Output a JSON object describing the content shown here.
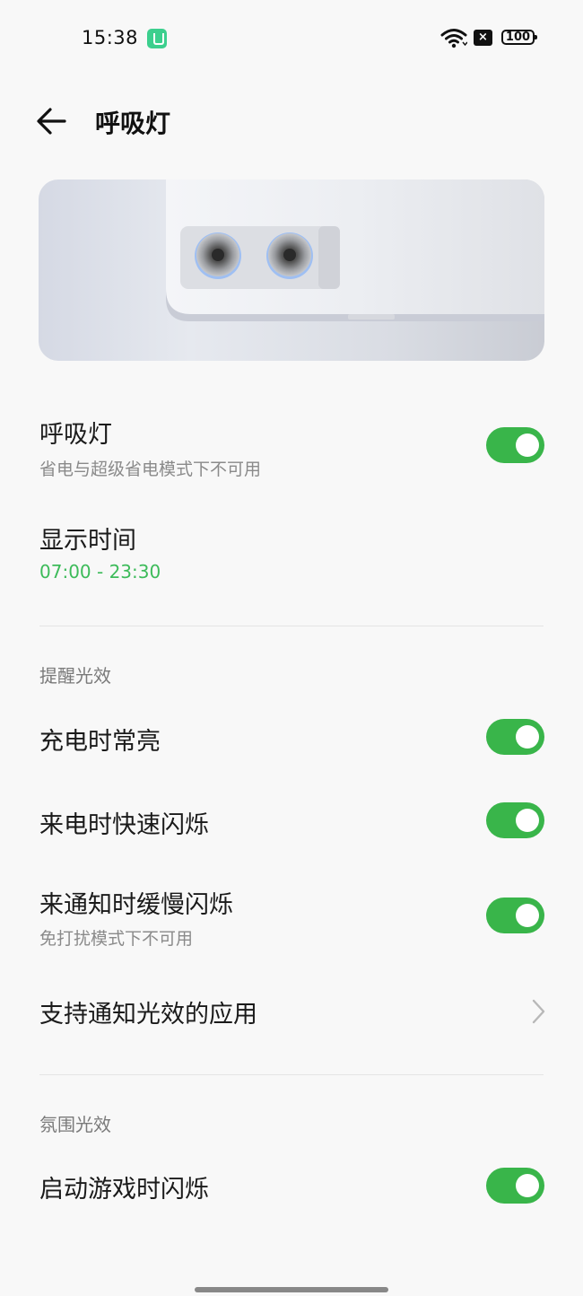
{
  "status_bar": {
    "time": "15:38",
    "battery": "100",
    "sim_status": "×"
  },
  "header": {
    "title": "呼吸灯"
  },
  "settings": {
    "breathing_light": {
      "title": "呼吸灯",
      "subtitle": "省电与超级省电模式下不可用",
      "enabled": true
    },
    "display_time": {
      "title": "显示时间",
      "value": "07:00 - 23:30"
    },
    "reminder_section": {
      "label": "提醒光效",
      "items": [
        {
          "title": "充电时常亮",
          "enabled": true
        },
        {
          "title": "来电时快速闪烁",
          "enabled": true
        },
        {
          "title": "来通知时缓慢闪烁",
          "subtitle": "免打扰模式下不可用",
          "enabled": true
        },
        {
          "title": "支持通知光效的应用"
        }
      ]
    },
    "ambient_section": {
      "label": "氛围光效",
      "items": [
        {
          "title": "启动游戏时闪烁",
          "enabled": true
        }
      ]
    }
  },
  "colors": {
    "accent": "#39b54a",
    "time_text": "#3dbb5a",
    "background": "#f8f8f8"
  },
  "icons": {
    "back": "arrow-left-icon",
    "chevron": "chevron-right-icon",
    "wifi": "wifi-icon"
  }
}
